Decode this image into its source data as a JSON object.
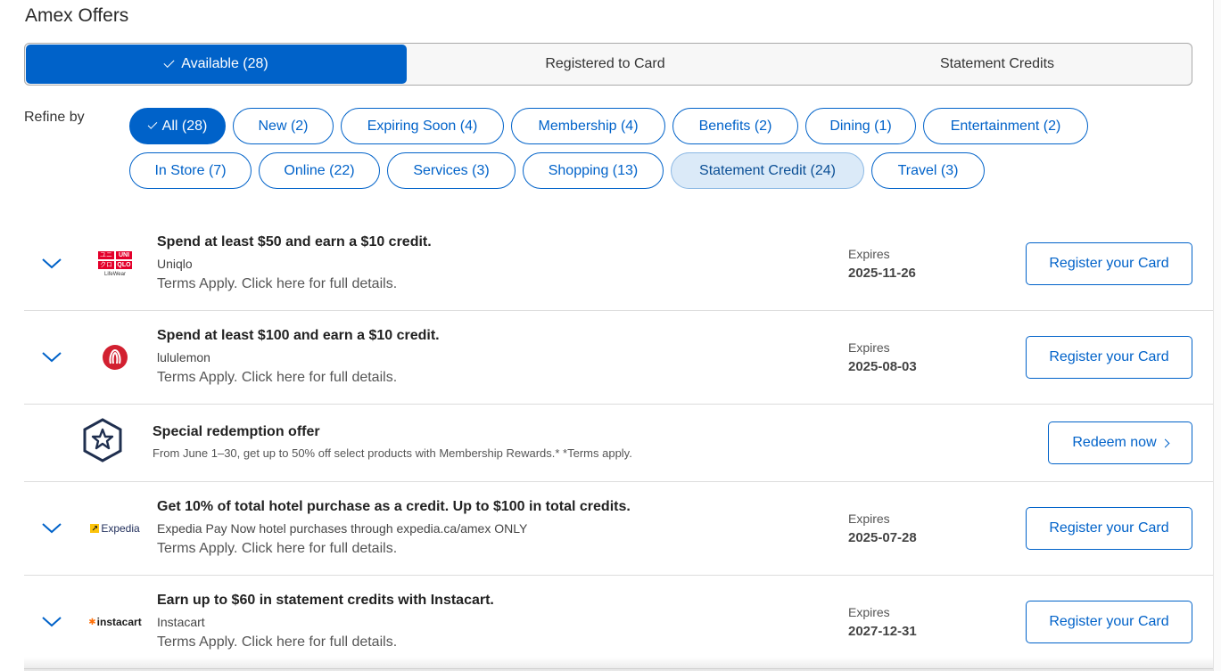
{
  "page": {
    "title": "Amex Offers"
  },
  "tabs": [
    {
      "label": "Available (28)",
      "active": true
    },
    {
      "label": "Registered to Card",
      "active": false
    },
    {
      "label": "Statement Credits",
      "active": false
    }
  ],
  "refine": {
    "label": "Refine by",
    "chips": [
      {
        "label": "All (28)",
        "state": "active"
      },
      {
        "label": "New (2)"
      },
      {
        "label": "Expiring Soon (4)"
      },
      {
        "label": "Membership (4)"
      },
      {
        "label": "Benefits (2)"
      },
      {
        "label": "Dining (1)"
      },
      {
        "label": "Entertainment (2)"
      },
      {
        "label": "In Store (7)"
      },
      {
        "label": "Online (22)"
      },
      {
        "label": "Services (3)"
      },
      {
        "label": "Shopping (13)"
      },
      {
        "label": "Statement Credit (24)",
        "state": "selected"
      },
      {
        "label": "Travel (3)"
      }
    ]
  },
  "offers": [
    {
      "title": "Spend at least $50 and earn a $10 credit.",
      "merchant": "Uniqlo",
      "terms": "Terms Apply. Click here for full details.",
      "expires_label": "Expires",
      "expires": "2025-11-26",
      "button": "Register your Card",
      "logo": {
        "top_left": "ユニ",
        "top_right": "UNI",
        "bottom_left": "クロ",
        "bottom_right": "QLO",
        "caption": "LifeWear"
      }
    },
    {
      "title": "Spend at least $100 and earn a $10 credit.",
      "merchant": "lululemon",
      "terms": "Terms Apply. Click here for full details.",
      "expires_label": "Expires",
      "expires": "2025-08-03",
      "button": "Register your Card"
    },
    {
      "title": "Get 10% of total hotel purchase as a credit. Up to $100 in total credits.",
      "merchant": "Expedia Pay Now hotel purchases through expedia.ca/amex ONLY",
      "terms": "Terms Apply. Click here for full details.",
      "expires_label": "Expires",
      "expires": "2025-07-28",
      "button": "Register your Card",
      "logo_text": "Expedia"
    },
    {
      "title": "Earn up to $60 in statement credits with Instacart.",
      "merchant": "Instacart",
      "terms": "Terms Apply. Click here for full details.",
      "expires_label": "Expires",
      "expires": "2027-12-31",
      "button": "Register your Card",
      "logo_text": "instacart"
    }
  ],
  "special": {
    "title": "Special redemption offer",
    "desc": "From June 1–30, get up to 50% off select products with Membership Rewards.* *Terms apply.",
    "button": "Redeem now"
  },
  "colors": {
    "brand_blue": "#0062c9",
    "uniqlo_red": "#e4002b",
    "lululemon_red": "#d22030",
    "instacart_orange": "#ff7009"
  }
}
